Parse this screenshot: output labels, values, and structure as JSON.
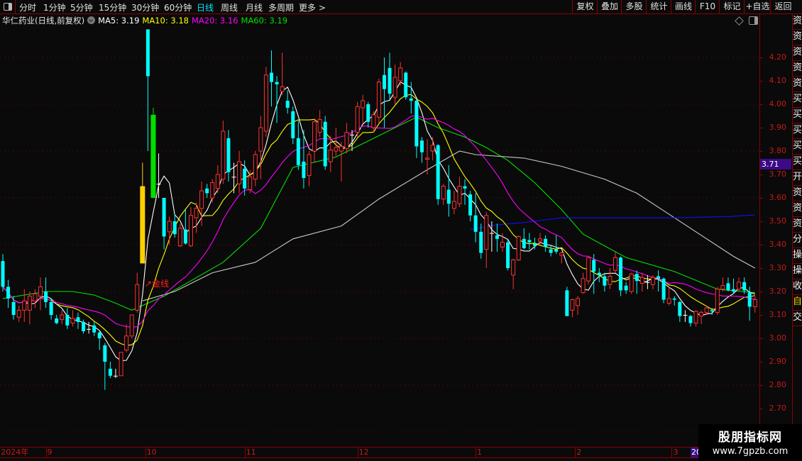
{
  "toolbar": {
    "periods": [
      "分时",
      "1分钟",
      "5分钟",
      "15分钟",
      "30分钟",
      "60分钟",
      "日线",
      "周线",
      "月线",
      "多周期",
      "更多 >"
    ],
    "active_period": "日线",
    "right_buttons": [
      "复权",
      "叠加",
      "多股",
      "统计",
      "画线",
      "F10",
      "标记",
      "+自选",
      "返回"
    ]
  },
  "title": {
    "stock": "华仁药业(日线,前复权)",
    "ma5": "MA5: 3.19",
    "ma10": "MA10: 3.18",
    "ma20": "MA20: 3.16",
    "ma60": "MA60: 3.19"
  },
  "colors": {
    "up": "#ff3232",
    "down": "#00ffff",
    "doji": "#ffffff",
    "ma5": "#ffffff",
    "ma10": "#ffff00",
    "ma20": "#ff00ff",
    "ma60": "#00e000",
    "gray_line": "#c8c8c8",
    "blue_line": "#1010ff",
    "grid": "#8b0000",
    "special_yellow": "#ffd000",
    "special_green": "#00e000"
  },
  "gold_label": "金线",
  "current_price": "3.71",
  "right_tabs": [
    "资",
    "资",
    "资",
    "资",
    "资",
    "买",
    "买",
    "买",
    "买",
    "买",
    "开",
    "资",
    "资",
    "资",
    "分",
    "操",
    "操",
    "收",
    "自",
    "交"
  ],
  "watermark": {
    "title": "股朋指标网",
    "url": "www.7gpzb.com"
  },
  "chart_data": {
    "type": "candlestick",
    "ylim": [
      2.6,
      4.33
    ],
    "yticks": [
      "4.20",
      "4.10",
      "4.00",
      "3.90",
      "3.80",
      "3.70",
      "3.60",
      "3.50",
      "3.40",
      "3.30",
      "3.20",
      "3.10",
      "3.00",
      "2.90",
      "2.80",
      "2.70"
    ],
    "grid_prices": [
      4.2,
      4.0,
      3.8,
      3.6,
      3.4,
      3.2,
      3.0,
      2.8,
      2.6
    ],
    "time_labels": [
      {
        "label": "2024年",
        "index": -0.5
      },
      {
        "label": "9",
        "index": 8
      },
      {
        "label": "10",
        "index": 26.5
      },
      {
        "label": "11",
        "index": 45
      },
      {
        "label": "12",
        "index": 66
      },
      {
        "label": "1",
        "index": 88
      },
      {
        "label": "2",
        "index": 106.5
      },
      {
        "label": "3",
        "index": 124.5
      }
    ],
    "cursor_date": {
      "label": "20",
      "index": 128
    },
    "special_candles": {
      "26": "special_yellow",
      "28": "special_green"
    },
    "ohlc": [
      [
        3.33,
        3.36,
        3.2,
        3.22
      ],
      [
        3.22,
        3.25,
        3.13,
        3.17
      ],
      [
        3.155,
        3.18,
        3.08,
        3.1
      ],
      [
        3.09,
        3.14,
        3.07,
        3.12
      ],
      [
        3.12,
        3.21,
        3.07,
        3.16
      ],
      [
        3.12,
        3.2,
        3.06,
        3.18
      ],
      [
        3.16,
        3.21,
        3.13,
        3.19
      ],
      [
        3.18,
        3.26,
        3.12,
        3.22
      ],
      [
        3.2,
        3.26,
        3.13,
        3.155
      ],
      [
        3.155,
        3.17,
        3.08,
        3.1
      ],
      [
        3.085,
        3.1,
        3.06,
        3.065
      ],
      [
        3.08,
        3.12,
        3.06,
        3.1
      ],
      [
        3.1,
        3.13,
        3.04,
        3.055
      ],
      [
        3.065,
        3.12,
        3.05,
        3.085
      ],
      [
        3.09,
        3.11,
        3.04,
        3.07
      ],
      [
        3.07,
        3.08,
        3.02,
        3.03
      ],
      [
        3.04,
        3.07,
        3.02,
        3.04
      ],
      [
        3.055,
        3.07,
        3.01,
        3.025
      ],
      [
        3.025,
        3.03,
        2.95,
        3.0
      ],
      [
        2.97,
        2.98,
        2.78,
        2.9
      ],
      [
        2.87,
        2.9,
        2.83,
        2.84
      ],
      [
        2.84,
        2.87,
        2.83,
        2.84
      ],
      [
        2.84,
        2.94,
        2.84,
        2.94
      ],
      [
        2.95,
        3.06,
        2.94,
        3.01
      ],
      [
        3.01,
        3.1,
        3.0,
        3.1
      ],
      [
        3.12,
        3.28,
        3.11,
        3.23
      ],
      [
        3.32,
        3.75,
        3.32,
        3.65
      ],
      [
        4.32,
        4.32,
        3.8,
        4.12
      ],
      [
        3.955,
        3.985,
        3.6,
        3.6
      ],
      [
        3.66,
        3.79,
        3.6,
        3.66
      ],
      [
        3.6,
        3.6,
        3.38,
        3.435
      ],
      [
        3.455,
        3.52,
        3.4,
        3.5
      ],
      [
        3.5,
        3.53,
        3.43,
        3.445
      ],
      [
        3.395,
        3.49,
        3.39,
        3.47
      ],
      [
        3.465,
        3.55,
        3.4,
        3.405
      ],
      [
        3.395,
        3.56,
        3.39,
        3.525
      ],
      [
        3.515,
        3.58,
        3.45,
        3.555
      ],
      [
        3.555,
        3.67,
        3.48,
        3.63
      ],
      [
        3.64,
        3.66,
        3.6,
        3.62
      ],
      [
        3.6,
        3.68,
        3.58,
        3.665
      ],
      [
        3.64,
        3.74,
        3.62,
        3.7
      ],
      [
        3.68,
        3.93,
        3.66,
        3.885
      ],
      [
        3.855,
        3.89,
        3.67,
        3.71
      ],
      [
        3.69,
        3.75,
        3.62,
        3.69
      ],
      [
        3.66,
        3.8,
        3.62,
        3.755
      ],
      [
        3.725,
        3.76,
        3.61,
        3.64
      ],
      [
        3.635,
        3.72,
        3.62,
        3.69
      ],
      [
        3.68,
        3.8,
        3.65,
        3.785
      ],
      [
        3.8,
        3.95,
        3.68,
        3.9
      ],
      [
        3.885,
        4.16,
        3.86,
        4.125
      ],
      [
        4.135,
        4.23,
        3.99,
        4.095
      ],
      [
        4.095,
        4.12,
        3.92,
        4.085
      ],
      [
        4.055,
        4.22,
        4.04,
        4.075
      ],
      [
        4.015,
        4.06,
        3.96,
        3.985
      ],
      [
        3.97,
        3.99,
        3.83,
        3.855
      ],
      [
        3.855,
        3.93,
        3.72,
        3.74
      ],
      [
        3.755,
        3.89,
        3.64,
        3.685
      ],
      [
        3.695,
        3.8,
        3.65,
        3.785
      ],
      [
        3.8,
        3.94,
        3.75,
        3.925
      ],
      [
        3.88,
        3.975,
        3.86,
        3.935
      ],
      [
        3.925,
        3.95,
        3.72,
        3.735
      ],
      [
        3.755,
        3.865,
        3.71,
        3.805
      ],
      [
        3.8,
        3.9,
        3.78,
        3.815
      ],
      [
        3.8,
        3.84,
        3.67,
        3.82
      ],
      [
        3.81,
        3.92,
        3.79,
        3.88
      ],
      [
        3.87,
        3.89,
        3.8,
        3.87
      ],
      [
        3.88,
        4.01,
        3.86,
        3.99
      ],
      [
        3.985,
        4.04,
        3.92,
        4.015
      ],
      [
        4.0,
        4.01,
        3.9,
        3.925
      ],
      [
        3.9,
        3.97,
        3.88,
        3.955
      ],
      [
        3.945,
        4.11,
        3.92,
        4.095
      ],
      [
        4.125,
        4.2,
        3.9,
        4.065
      ],
      [
        4.155,
        4.22,
        4.02,
        4.045
      ],
      [
        4.03,
        4.17,
        4.0,
        4.115
      ],
      [
        4.1,
        4.18,
        4.08,
        4.155
      ],
      [
        4.135,
        4.14,
        4.02,
        4.03
      ],
      [
        4.025,
        4.095,
        3.96,
        4.015
      ],
      [
        4.015,
        4.02,
        3.77,
        3.82
      ],
      [
        3.845,
        3.86,
        3.75,
        3.795
      ],
      [
        3.765,
        3.85,
        3.7,
        3.77
      ],
      [
        3.8,
        3.86,
        3.76,
        3.825
      ],
      [
        3.825,
        3.83,
        3.57,
        3.595
      ],
      [
        3.595,
        3.66,
        3.57,
        3.65
      ],
      [
        3.635,
        3.74,
        3.52,
        3.575
      ],
      [
        3.555,
        3.63,
        3.53,
        3.585
      ],
      [
        3.575,
        3.69,
        3.56,
        3.65
      ],
      [
        3.65,
        3.68,
        3.57,
        3.64
      ],
      [
        3.615,
        3.63,
        3.5,
        3.525
      ],
      [
        3.525,
        3.62,
        3.41,
        3.455
      ],
      [
        3.455,
        3.49,
        3.34,
        3.365
      ],
      [
        3.38,
        3.54,
        3.3,
        3.525
      ],
      [
        3.45,
        3.5,
        3.37,
        3.45
      ],
      [
        3.44,
        3.49,
        3.37,
        3.425
      ],
      [
        3.39,
        3.45,
        3.37,
        3.41
      ],
      [
        3.41,
        3.42,
        3.29,
        3.3
      ],
      [
        3.27,
        3.34,
        3.21,
        3.335
      ],
      [
        3.335,
        3.44,
        3.33,
        3.435
      ],
      [
        3.425,
        3.47,
        3.38,
        3.385
      ],
      [
        3.42,
        3.45,
        3.38,
        3.41
      ],
      [
        3.405,
        3.43,
        3.38,
        3.395
      ],
      [
        3.415,
        3.45,
        3.4,
        3.425
      ],
      [
        3.425,
        3.44,
        3.37,
        3.39
      ],
      [
        3.38,
        3.4,
        3.35,
        3.365
      ],
      [
        3.38,
        3.44,
        3.36,
        3.37
      ],
      [
        3.355,
        3.37,
        3.32,
        3.365
      ],
      [
        3.205,
        3.22,
        3.095,
        3.095
      ],
      [
        3.12,
        3.17,
        3.09,
        3.165
      ],
      [
        3.14,
        3.18,
        3.1,
        3.17
      ],
      [
        3.195,
        3.28,
        3.19,
        3.255
      ],
      [
        3.245,
        3.35,
        3.23,
        3.345
      ],
      [
        3.335,
        3.36,
        3.19,
        3.285
      ],
      [
        3.28,
        3.3,
        3.24,
        3.27
      ],
      [
        3.265,
        3.28,
        3.2,
        3.225
      ],
      [
        3.23,
        3.3,
        3.21,
        3.265
      ],
      [
        3.29,
        3.37,
        3.28,
        3.345
      ],
      [
        3.345,
        3.35,
        3.18,
        3.205
      ],
      [
        3.225,
        3.24,
        3.19,
        3.205
      ],
      [
        3.2,
        3.28,
        3.19,
        3.275
      ],
      [
        3.275,
        3.29,
        3.19,
        3.245
      ],
      [
        3.235,
        3.28,
        3.2,
        3.26
      ],
      [
        3.24,
        3.27,
        3.21,
        3.24
      ],
      [
        3.23,
        3.27,
        3.21,
        3.26
      ],
      [
        3.265,
        3.29,
        3.2,
        3.255
      ],
      [
        3.255,
        3.26,
        3.15,
        3.165
      ],
      [
        3.15,
        3.22,
        3.14,
        3.17
      ],
      [
        3.17,
        3.18,
        3.14,
        3.165
      ],
      [
        3.155,
        3.16,
        3.07,
        3.095
      ],
      [
        3.1,
        3.12,
        3.07,
        3.1
      ],
      [
        3.095,
        3.1,
        3.05,
        3.065
      ],
      [
        3.065,
        3.12,
        3.05,
        3.115
      ],
      [
        3.095,
        3.12,
        3.06,
        3.11
      ],
      [
        3.11,
        3.14,
        3.1,
        3.13
      ],
      [
        3.12,
        3.13,
        3.1,
        3.115
      ],
      [
        3.11,
        3.22,
        3.1,
        3.21
      ],
      [
        3.21,
        3.26,
        3.2,
        3.225
      ],
      [
        3.235,
        3.26,
        3.2,
        3.205
      ],
      [
        3.21,
        3.255,
        3.19,
        3.2
      ],
      [
        3.21,
        3.26,
        3.2,
        3.24
      ],
      [
        3.24,
        3.26,
        3.19,
        3.205
      ],
      [
        3.195,
        3.22,
        3.075,
        3.135
      ],
      [
        3.135,
        3.18,
        3.11,
        3.165
      ]
    ],
    "moving_averages": [
      {
        "name": "MA5",
        "period": 5,
        "color": "ma5"
      },
      {
        "name": "MA10",
        "period": 10,
        "color": "ma10"
      },
      {
        "name": "MA20",
        "period": 20,
        "color": "ma20"
      }
    ],
    "extra_lines": [
      {
        "name": "MA60",
        "color": "ma60",
        "points": [
          [
            0,
            3.17
          ],
          [
            8,
            3.2
          ],
          [
            13,
            3.2
          ],
          [
            17,
            3.185
          ],
          [
            21,
            3.15
          ],
          [
            24,
            3.12
          ],
          [
            26,
            3.14
          ],
          [
            30,
            3.18
          ],
          [
            41,
            3.325
          ],
          [
            48,
            3.47
          ],
          [
            54,
            3.73
          ],
          [
            62,
            3.775
          ],
          [
            73,
            3.9
          ],
          [
            77,
            3.945
          ],
          [
            81,
            3.9
          ],
          [
            86,
            3.86
          ],
          [
            90,
            3.815
          ],
          [
            94,
            3.76
          ],
          [
            99,
            3.665
          ],
          [
            104,
            3.55
          ],
          [
            108,
            3.445
          ],
          [
            116,
            3.345
          ],
          [
            125,
            3.285
          ],
          [
            133,
            3.21
          ],
          [
            140,
            3.195
          ]
        ]
      },
      {
        "name": "gold-line",
        "color": "gray_line",
        "points": [
          [
            26,
            3.16
          ],
          [
            32,
            3.2
          ],
          [
            39,
            3.28
          ],
          [
            47,
            3.325
          ],
          [
            54,
            3.425
          ],
          [
            63,
            3.48
          ],
          [
            70,
            3.595
          ],
          [
            79,
            3.72
          ],
          [
            85,
            3.8
          ],
          [
            88,
            3.785
          ],
          [
            97,
            3.77
          ],
          [
            104,
            3.735
          ],
          [
            112,
            3.68
          ],
          [
            118,
            3.62
          ],
          [
            124,
            3.53
          ],
          [
            130,
            3.44
          ],
          [
            136,
            3.35
          ],
          [
            140,
            3.3
          ]
        ]
      },
      {
        "name": "blue-line",
        "color": "blue_line",
        "points": [
          [
            87,
            3.465
          ],
          [
            92,
            3.485
          ],
          [
            97,
            3.495
          ],
          [
            104,
            3.515
          ],
          [
            115,
            3.515
          ],
          [
            125,
            3.515
          ],
          [
            135,
            3.52
          ],
          [
            140,
            3.527
          ]
        ]
      }
    ]
  }
}
